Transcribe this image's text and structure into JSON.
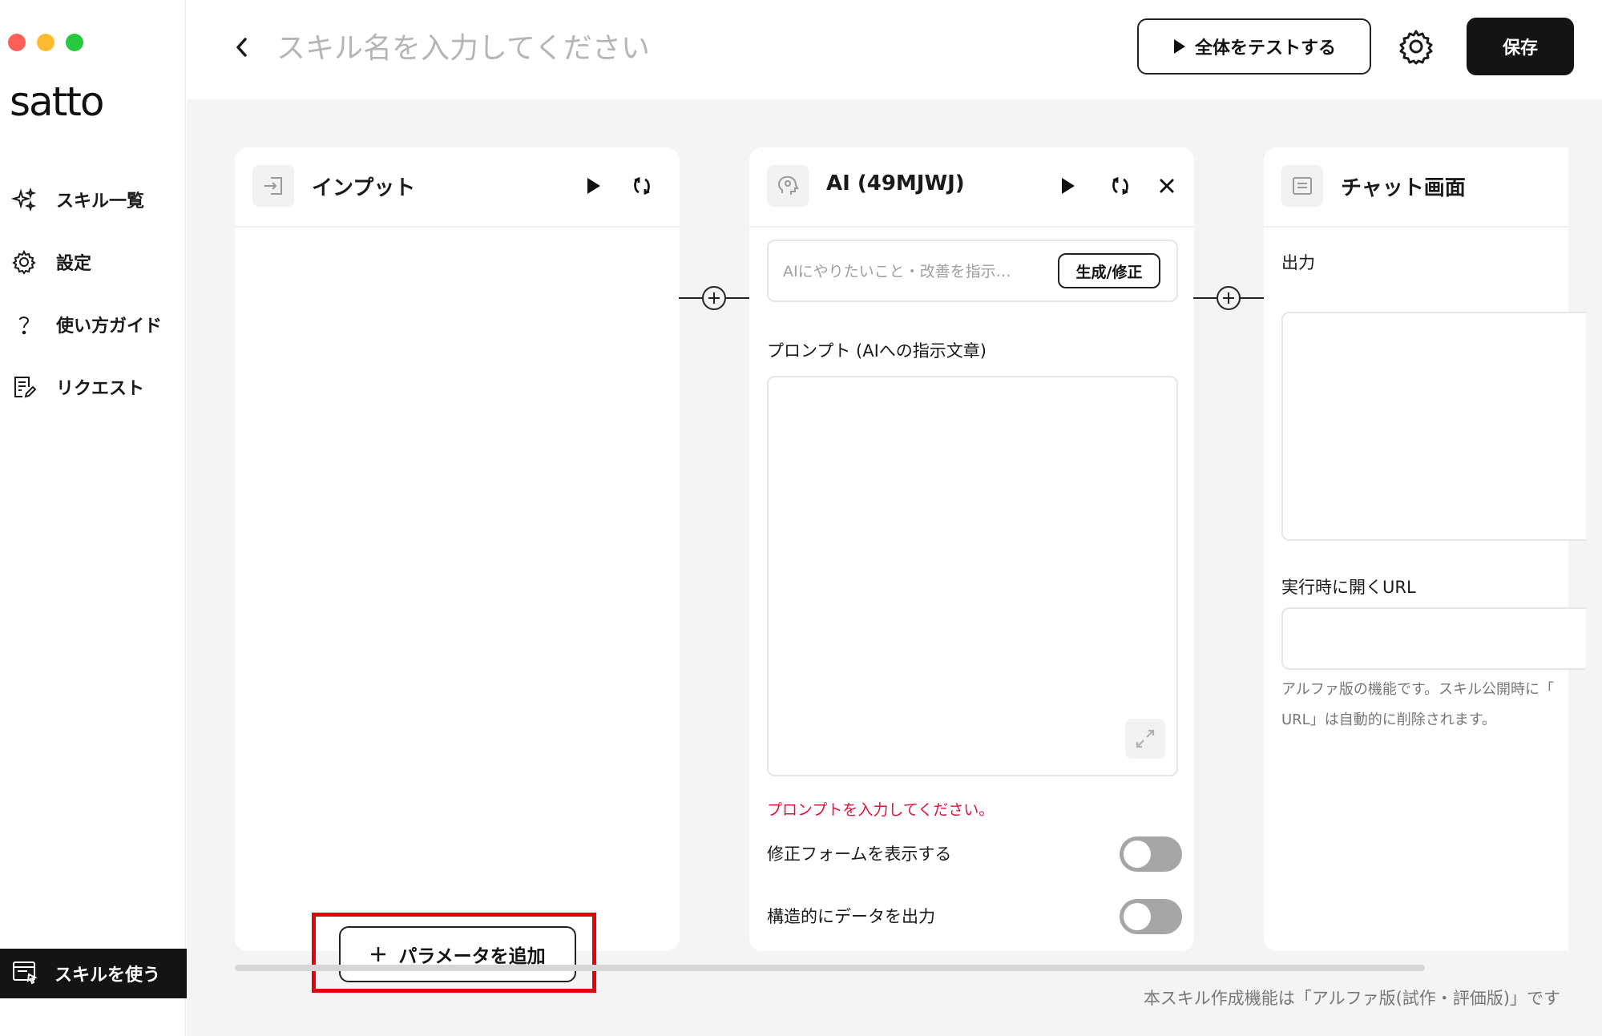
{
  "window": {
    "traffic_lights": [
      "close",
      "minimize",
      "zoom"
    ],
    "colors": {
      "close": "#fe5f57",
      "minimize": "#febc2e",
      "zoom": "#28c840"
    }
  },
  "sidebar": {
    "logo": "satto",
    "items": [
      {
        "label": "スキル一覧",
        "icon": "sparkles-icon"
      },
      {
        "label": "設定",
        "icon": "gear-icon"
      },
      {
        "label": "使い方ガイド",
        "icon": "question-icon"
      },
      {
        "label": "リクエスト",
        "icon": "document-edit-icon"
      }
    ],
    "use_skill_label": "スキルを使う"
  },
  "header": {
    "skill_name_placeholder": "スキル名を入力してください",
    "test_all_label": "全体をテストする",
    "save_label": "保存"
  },
  "cards": {
    "input": {
      "title": "インプット",
      "add_param_label": "パラメータを追加"
    },
    "ai": {
      "title": "AI (49MJWJ)",
      "instruction_placeholder": "AIにやりたいこと・改善を指示…",
      "generate_label": "生成/修正",
      "prompt_label": "プロンプト (AIへの指示文章)",
      "prompt_error": "プロンプトを入力してください。",
      "toggle_form_label": "修正フォームを表示する",
      "toggle_form_on": false,
      "toggle_struct_label": "構造的にデータを出力",
      "toggle_struct_on": false
    },
    "chat": {
      "title": "チャット画面",
      "output_label": "出力",
      "url_label": "実行時に開くURL",
      "note_line1": "アルファ版の機能です。スキル公開時に「",
      "note_line2": "URL」は自動的に削除されます。"
    }
  },
  "footer": {
    "alpha_note": "本スキル作成機能は「アルファ版(試作・評価版)」です"
  },
  "colors": {
    "accent_dark": "#141414",
    "error": "#e0133b",
    "highlight": "#e8000b",
    "canvas_bg": "#f4f4f4"
  }
}
